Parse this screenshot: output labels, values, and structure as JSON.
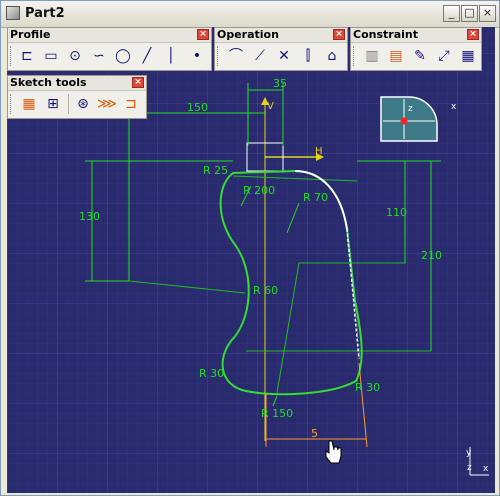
{
  "window": {
    "title": "Part2",
    "minimize": "_",
    "maximize": "□",
    "close": "×"
  },
  "toolbars": {
    "profile": {
      "title": "Profile",
      "close": "×"
    },
    "operation": {
      "title": "Operation",
      "close": "×"
    },
    "constraint": {
      "title": "Constraint",
      "close": "×"
    },
    "sketch_tools": {
      "title": "Sketch tools",
      "close": "×"
    }
  },
  "compass": {
    "z_label": "z",
    "x_label": "x"
  },
  "axis_labels": {
    "h": "H",
    "v": "V"
  },
  "triad": {
    "y": "y",
    "z": "z",
    "x": "x"
  },
  "dimensions": {
    "d35": "35",
    "d150_top": "150",
    "r25": "R 25",
    "r200": "R 200",
    "r70": "R 70",
    "d130": "130",
    "d110": "110",
    "d210": "210",
    "r60": "R 60",
    "r30_left": "R 30",
    "r30_right": "R 30",
    "r150": "R 150",
    "d5": "5"
  },
  "colors": {
    "canvas": "#2a2a6e",
    "grid": "#3a3a86",
    "sketch": "#33dd33",
    "selected": "#ffffff",
    "dim": "#22dd22",
    "axis": "#e6d21a",
    "orange_dim": "#ff9a30"
  }
}
